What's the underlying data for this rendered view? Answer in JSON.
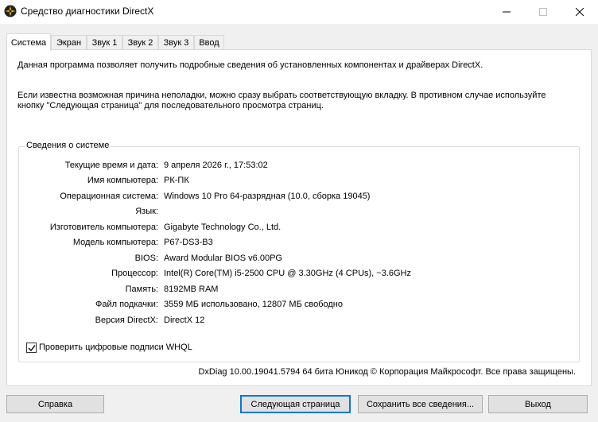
{
  "window": {
    "title": "Средство диагностики DirectX",
    "controls": {
      "minimize_icon": "minimize-icon",
      "maximize_icon": "maximize-icon",
      "close_icon": "close-icon"
    }
  },
  "tabs": [
    {
      "label": "Система",
      "active": true
    },
    {
      "label": "Экран"
    },
    {
      "label": "Звук 1"
    },
    {
      "label": "Звук 2"
    },
    {
      "label": "Звук 3"
    },
    {
      "label": "Ввод"
    }
  ],
  "panel": {
    "intro": "Данная программа позволяет получить подробные сведения об установленных компонентах и драйверах DirectX.",
    "hint": "Если известна возможная причина неполадки, можно сразу выбрать соответствующую вкладку. В противном случае используйте кнопку \"Следующая страница\" для последовательного просмотра страниц.",
    "group_title": "Сведения о системе",
    "system_info": [
      {
        "label": "Текущие время и дата:",
        "value": "9 апреля 2026 г., 17:53:02"
      },
      {
        "label": "Имя компьютера:",
        "value": "РК-ПК"
      },
      {
        "label": "Операционная система:",
        "value": "Windows 10 Pro 64-разрядная (10.0, сборка 19045)"
      },
      {
        "label": "Язык:",
        "value": ""
      },
      {
        "label": "Изготовитель компьютера:",
        "value": "Gigabyte Technology Co., Ltd."
      },
      {
        "label": "Модель компьютера:",
        "value": "P67-DS3-B3"
      },
      {
        "label": "BIOS:",
        "value": "Award Modular BIOS v6.00PG"
      },
      {
        "label": "Процессор:",
        "value": "Intel(R) Core(TM) i5-2500 CPU @ 3.30GHz (4 CPUs), ~3.6GHz"
      },
      {
        "label": "Память:",
        "value": "8192MB RAM"
      },
      {
        "label": "Файл подкачки:",
        "value": "3559 МБ использовано, 12807 МБ свободно"
      },
      {
        "label": "Версия DirectX:",
        "value": "DirectX 12"
      }
    ],
    "whql_checkbox": {
      "label": "Проверить цифровые подписи WHQL",
      "checked": true
    }
  },
  "footer": "DxDiag 10.00.19041.5794 64 бита Юникод © Корпорация Майкрософт. Все права защищены.",
  "buttons": {
    "help": "Справка",
    "next": "Следующая страница",
    "save_all": "Сохранить все сведения...",
    "exit": "Выход"
  }
}
